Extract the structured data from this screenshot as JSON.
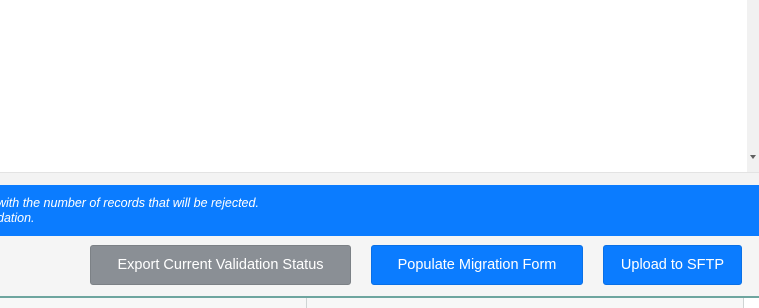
{
  "colors": {
    "banner": "#0b7cff",
    "primary_button": "#0b7cff",
    "secondary_button": "#8a8f95",
    "bottom_accent": "#6ea59f"
  },
  "info_banner": {
    "line1": "with the number of records that will be rejected.",
    "line2": "dation."
  },
  "actions": {
    "export_label": "Export Current Validation Status",
    "populate_label": "Populate Migration Form",
    "upload_label": "Upload to SFTP"
  }
}
